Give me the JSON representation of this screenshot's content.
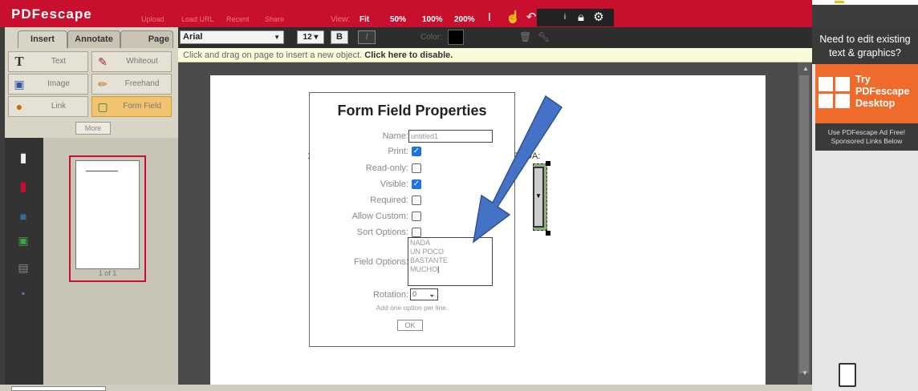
{
  "app": {
    "logo": "PDFescape",
    "nav": [
      "Upload",
      "Load URL",
      "Recent",
      "Share"
    ],
    "view_label": "View:",
    "zoom_options": [
      "Fit",
      "50%",
      "100%",
      "200%"
    ]
  },
  "colors": {
    "brand_red": "#c8102e",
    "promo_orange": "#ef6b2b",
    "active_tool": "#f2c472",
    "checkbox_blue": "#1a73e8"
  },
  "left_panel": {
    "tabs": [
      "Insert",
      "Annotate",
      "Page"
    ],
    "tools": [
      {
        "label": "Text",
        "icon": "text-icon"
      },
      {
        "label": "Whiteout",
        "icon": "whiteout-icon"
      },
      {
        "label": "Image",
        "icon": "image-icon"
      },
      {
        "label": "Freehand",
        "icon": "pencil-icon"
      },
      {
        "label": "Link",
        "icon": "link-icon"
      },
      {
        "label": "Form Field",
        "icon": "form-field-icon",
        "active": true
      }
    ],
    "more_label": "More"
  },
  "font_toolbar": {
    "font": "Arial",
    "size": "12 ▾",
    "bold": "B",
    "italic": "I",
    "color_label": "Color:",
    "color_value": "#000000"
  },
  "hint": {
    "text": "Click and drag on page to insert a new object.",
    "link": "Click here to disable."
  },
  "thumbnail": {
    "page_label": "1 of 1"
  },
  "page": {
    "text_left": "1",
    "text_right": "ZADA:"
  },
  "dialog": {
    "title": "Form Field Properties",
    "name_label": "Name:",
    "name_value": "untitled1",
    "fields": [
      {
        "label": "Print:",
        "checked": true
      },
      {
        "label": "Read-only:",
        "checked": false
      },
      {
        "label": "Visible:",
        "checked": true
      },
      {
        "label": "Required:",
        "checked": false
      },
      {
        "label": "Allow Custom:",
        "checked": false
      },
      {
        "label": "Sort Options:",
        "checked": false
      }
    ],
    "options_label": "Field Options:",
    "options": [
      "NADA",
      "UN POCO",
      "BASTANTE",
      "MUCHO"
    ],
    "rotation_label": "Rotation:",
    "rotation_value": "0",
    "hint": "Add one option per line.",
    "ok_label": "OK"
  },
  "right_ad": {
    "headline": "Need to edit existing text & graphics?",
    "promo_line1": "Try",
    "promo_line2": "PDFescape",
    "promo_line3": "Desktop",
    "subtext": "Use PDFescape Ad Free! Sponsored Links Below"
  }
}
